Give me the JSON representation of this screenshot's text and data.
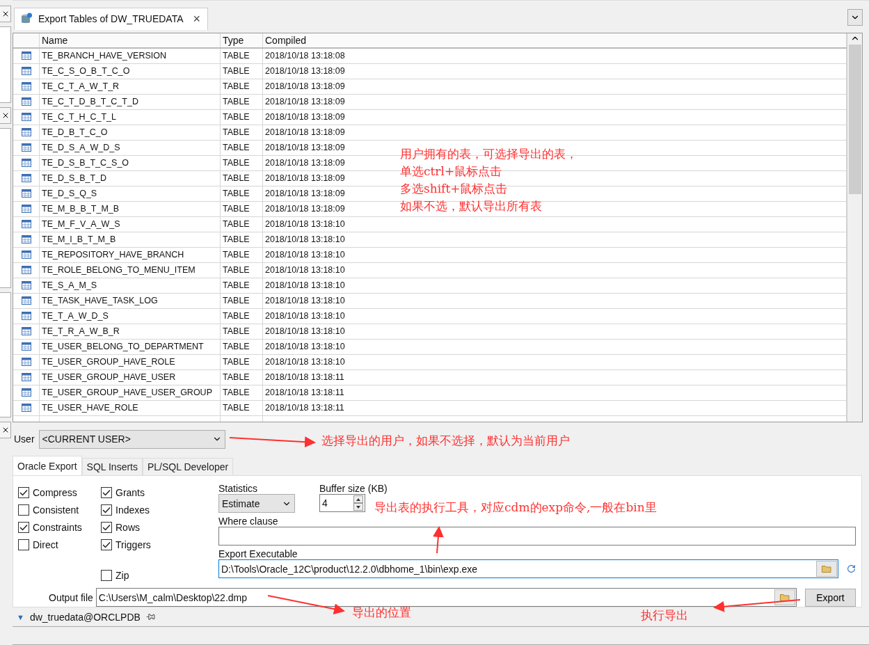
{
  "tab": {
    "title": "Export Tables of DW_TRUEDATA",
    "close": "×"
  },
  "table": {
    "columns": [
      "Name",
      "Type",
      "Compiled"
    ],
    "rows": [
      {
        "name": "TE_BRANCH_HAVE_VERSION",
        "type": "TABLE",
        "compiled": "2018/10/18 13:18:08"
      },
      {
        "name": "TE_C_S_O_B_T_C_O",
        "type": "TABLE",
        "compiled": "2018/10/18 13:18:09"
      },
      {
        "name": "TE_C_T_A_W_T_R",
        "type": "TABLE",
        "compiled": "2018/10/18 13:18:09"
      },
      {
        "name": "TE_C_T_D_B_T_C_T_D",
        "type": "TABLE",
        "compiled": "2018/10/18 13:18:09"
      },
      {
        "name": "TE_C_T_H_C_T_L",
        "type": "TABLE",
        "compiled": "2018/10/18 13:18:09"
      },
      {
        "name": "TE_D_B_T_C_O",
        "type": "TABLE",
        "compiled": "2018/10/18 13:18:09"
      },
      {
        "name": "TE_D_S_A_W_D_S",
        "type": "TABLE",
        "compiled": "2018/10/18 13:18:09"
      },
      {
        "name": "TE_D_S_B_T_C_S_O",
        "type": "TABLE",
        "compiled": "2018/10/18 13:18:09"
      },
      {
        "name": "TE_D_S_B_T_D",
        "type": "TABLE",
        "compiled": "2018/10/18 13:18:09"
      },
      {
        "name": "TE_D_S_Q_S",
        "type": "TABLE",
        "compiled": "2018/10/18 13:18:09"
      },
      {
        "name": "TE_M_B_B_T_M_B",
        "type": "TABLE",
        "compiled": "2018/10/18 13:18:09"
      },
      {
        "name": "TE_M_F_V_A_W_S",
        "type": "TABLE",
        "compiled": "2018/10/18 13:18:10"
      },
      {
        "name": "TE_M_I_B_T_M_B",
        "type": "TABLE",
        "compiled": "2018/10/18 13:18:10"
      },
      {
        "name": "TE_REPOSITORY_HAVE_BRANCH",
        "type": "TABLE",
        "compiled": "2018/10/18 13:18:10"
      },
      {
        "name": "TE_ROLE_BELONG_TO_MENU_ITEM",
        "type": "TABLE",
        "compiled": "2018/10/18 13:18:10"
      },
      {
        "name": "TE_S_A_M_S",
        "type": "TABLE",
        "compiled": "2018/10/18 13:18:10"
      },
      {
        "name": "TE_TASK_HAVE_TASK_LOG",
        "type": "TABLE",
        "compiled": "2018/10/18 13:18:10"
      },
      {
        "name": "TE_T_A_W_D_S",
        "type": "TABLE",
        "compiled": "2018/10/18 13:18:10"
      },
      {
        "name": "TE_T_R_A_W_B_R",
        "type": "TABLE",
        "compiled": "2018/10/18 13:18:10"
      },
      {
        "name": "TE_USER_BELONG_TO_DEPARTMENT",
        "type": "TABLE",
        "compiled": "2018/10/18 13:18:10"
      },
      {
        "name": "TE_USER_GROUP_HAVE_ROLE",
        "type": "TABLE",
        "compiled": "2018/10/18 13:18:10"
      },
      {
        "name": "TE_USER_GROUP_HAVE_USER",
        "type": "TABLE",
        "compiled": "2018/10/18 13:18:11"
      },
      {
        "name": "TE_USER_GROUP_HAVE_USER_GROUP",
        "type": "TABLE",
        "compiled": "2018/10/18 13:18:11"
      },
      {
        "name": "TE_USER_HAVE_ROLE",
        "type": "TABLE",
        "compiled": "2018/10/18 13:18:11"
      }
    ]
  },
  "user": {
    "label": "User",
    "value": "<CURRENT USER>"
  },
  "option_tabs": [
    {
      "label": "Oracle Export",
      "selected": true
    },
    {
      "label": "SQL Inserts",
      "selected": false
    },
    {
      "label": "PL/SQL Developer",
      "selected": false
    }
  ],
  "option_columns": [
    [
      {
        "label": "Compress",
        "checked": true
      },
      {
        "label": "Consistent",
        "checked": false
      },
      {
        "label": "Constraints",
        "checked": true
      },
      {
        "label": "Direct",
        "checked": false
      }
    ],
    [
      {
        "label": "Grants",
        "checked": true
      },
      {
        "label": "Indexes",
        "checked": true
      },
      {
        "label": "Rows",
        "checked": true
      },
      {
        "label": "Triggers",
        "checked": true
      }
    ]
  ],
  "zip": {
    "label": "Zip",
    "checked": false
  },
  "statistics": {
    "label": "Statistics",
    "value": "Estimate"
  },
  "buffer_size": {
    "label": "Buffer size (KB)",
    "value": "4"
  },
  "where_clause": {
    "label": "Where clause"
  },
  "export_executable": {
    "label": "Export Executable",
    "value": "D:\\Tools\\Oracle_12C\\product\\12.2.0\\dbhome_1\\bin\\exp.exe"
  },
  "output_file": {
    "label": "Output file",
    "value": "C:\\Users\\M_calm\\Desktop\\22.dmp"
  },
  "export_button": "Export",
  "connection_caret": "▼",
  "connection": "dw_truedata@ORCLPDB",
  "annotations": [
    {
      "lines": [
        "用户拥有的表，可选择导出的表，",
        "单选ctrl+鼠标点击",
        "多选shift+鼠标点击",
        "如果不选，默认导出所有表"
      ]
    },
    {
      "lines": [
        "选择导出的用户，如果不选择，默认为当前用户"
      ]
    },
    {
      "lines": [
        "导出表的执行工具，对应cdm的exp命令,一般在bin里"
      ]
    },
    {
      "lines": [
        "导出的位置"
      ]
    },
    {
      "lines": [
        "执行导出"
      ]
    }
  ]
}
